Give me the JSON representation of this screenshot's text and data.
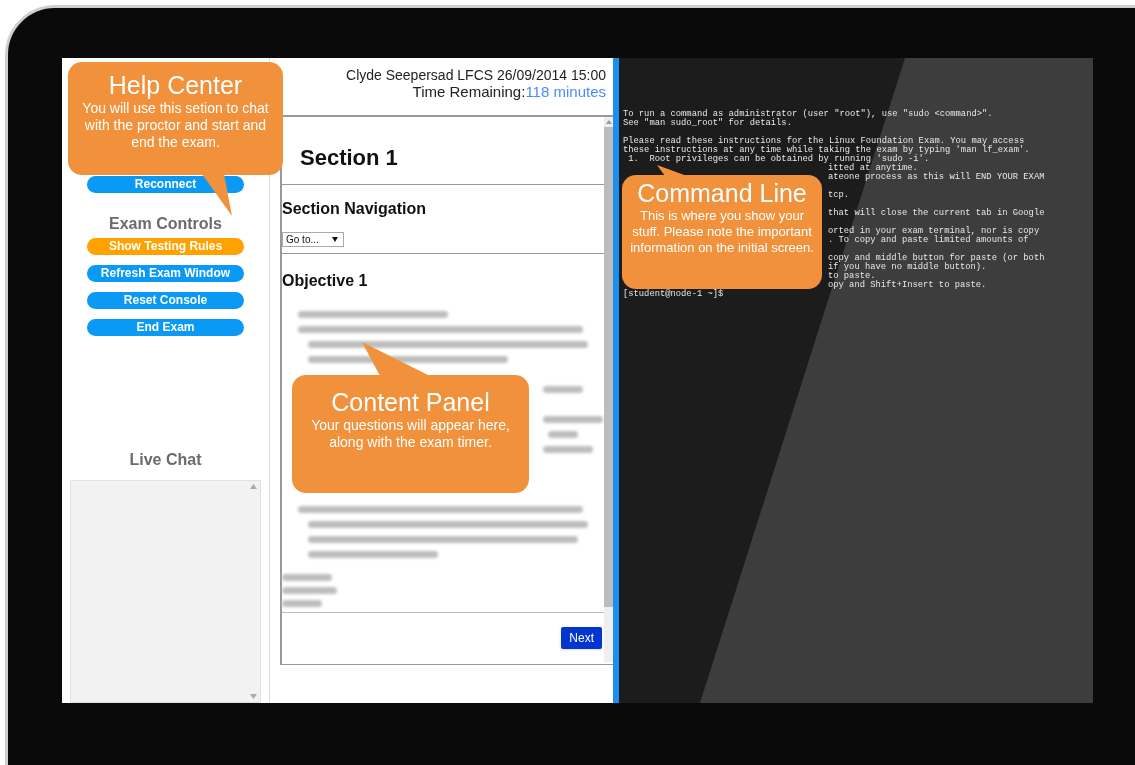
{
  "sidebar": {
    "buttons_top": [
      {
        "label": "Reconnect",
        "color": "#0a9af5"
      }
    ],
    "controls_heading": "Exam Controls",
    "controls": [
      {
        "label": "Show Testing Rules",
        "color": "#ffa200"
      },
      {
        "label": "Refresh Exam Window",
        "color": "#0a9af5"
      },
      {
        "label": "Reset Console",
        "color": "#0a9af5"
      },
      {
        "label": "End Exam",
        "color": "#0a9af5"
      }
    ],
    "chat_heading": "Live Chat"
  },
  "content": {
    "candidate": "Clyde Seepersad LFCS 26/09/2014 15:00",
    "time_label": "Time Remaining:",
    "time_value": "118 minutes",
    "section_title": "Section 1",
    "navigation_heading": "Section Navigation",
    "navigation_select": "Go to...",
    "objective_title": "Objective 1",
    "next_button": "Next"
  },
  "terminal": {
    "lines": [
      {
        "kind": "text",
        "text": "To run a command as administrator (user \"root\"), use \"sudo <command>\".",
        "covered": false
      },
      {
        "kind": "text",
        "text": "See \"man sudo_root\" for details.",
        "covered": false
      },
      {
        "kind": "blank"
      },
      {
        "kind": "text",
        "text": "Please read these instructions for the Linux Foundation Exam. You may access",
        "covered": false
      },
      {
        "kind": "text",
        "text": "these instructions at any time while taking the exam by typing 'man lf_exam'.",
        "covered": false
      },
      {
        "kind": "text",
        "text": " 1.  Root privileges can be obtained by running 'sudo -i'.",
        "covered": false
      },
      {
        "kind": "text",
        "text": "itted at anytime.",
        "covered": true
      },
      {
        "kind": "text",
        "text": "ateone process as this will END YOUR EXAM",
        "covered": true
      },
      {
        "kind": "blank"
      },
      {
        "kind": "text",
        "text": "tcp.",
        "covered": true
      },
      {
        "kind": "blank"
      },
      {
        "kind": "text",
        "text": "that will close the current tab in Google",
        "covered": true
      },
      {
        "kind": "blank"
      },
      {
        "kind": "text",
        "text": "orted in your exam terminal, nor is copy",
        "covered": true
      },
      {
        "kind": "text",
        "text": ". To copy and paste limited amounts of",
        "covered": true
      },
      {
        "kind": "blank"
      },
      {
        "kind": "text",
        "text": "copy and middle button for paste (or both",
        "covered": true
      },
      {
        "kind": "text",
        "text": "if you have no middle button).",
        "covered": true
      },
      {
        "kind": "text",
        "text": "to paste.",
        "covered": true
      },
      {
        "kind": "text",
        "text": "opy and Shift+Insert to paste.",
        "covered": true
      },
      {
        "kind": "text",
        "text": "[student@node-1 ~]$",
        "covered": false
      }
    ]
  },
  "help_callout": {
    "title": "Help Center",
    "text": "You will use this setion to chat with the proctor and start and end the exam."
  },
  "content_callout": {
    "title": "Content Panel",
    "text": "Your questions will appear here, along with the exam timer."
  },
  "command_callout": {
    "title": "Command Line",
    "text": "This is where you show your stuff. Please note the important information on the initial screen."
  }
}
